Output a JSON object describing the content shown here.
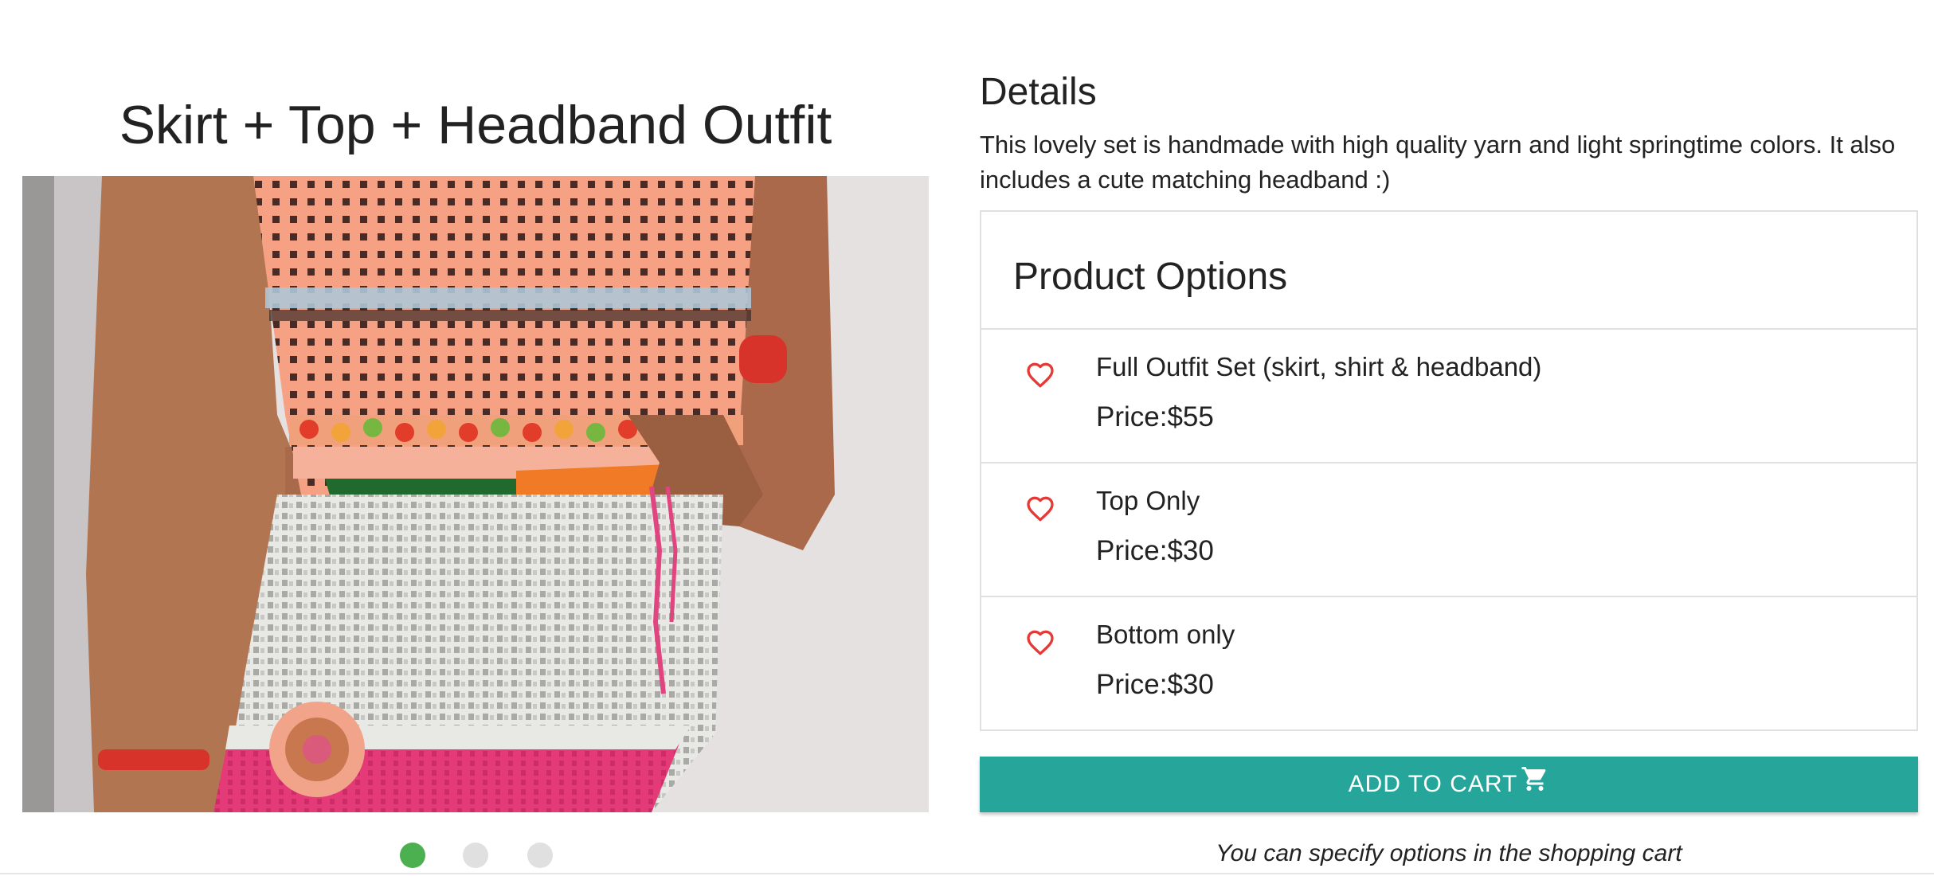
{
  "product": {
    "title": "Skirt + Top + Headband Outfit",
    "image_alt": "Crocheted peach top with granny-square pattern and grey/pink skirt",
    "carousel": {
      "slides": 3,
      "active_index": 0
    }
  },
  "details": {
    "heading": "Details",
    "text": "This lovely set is handmade with high quality yarn and light springtime colors. It also includes a cute matching headband :)"
  },
  "options": {
    "heading": "Product Options",
    "items": [
      {
        "name": "Full Outfit Set (skirt, shirt & headband)",
        "price": "Price:$55",
        "icon": "heart-outline-icon"
      },
      {
        "name": "Top Only",
        "price": "Price:$30",
        "icon": "heart-outline-icon"
      },
      {
        "name": "Bottom only",
        "price": "Price:$30",
        "icon": "heart-outline-icon"
      }
    ]
  },
  "cart": {
    "button_label": "ADD TO CART",
    "icon": "shopping-cart-icon",
    "hint": "You can specify options in the shopping cart"
  },
  "colors": {
    "accent": "#26a69a",
    "heart": "#e53935",
    "active_dot": "#4caf50",
    "inactive_dot": "#e0e0e0"
  }
}
